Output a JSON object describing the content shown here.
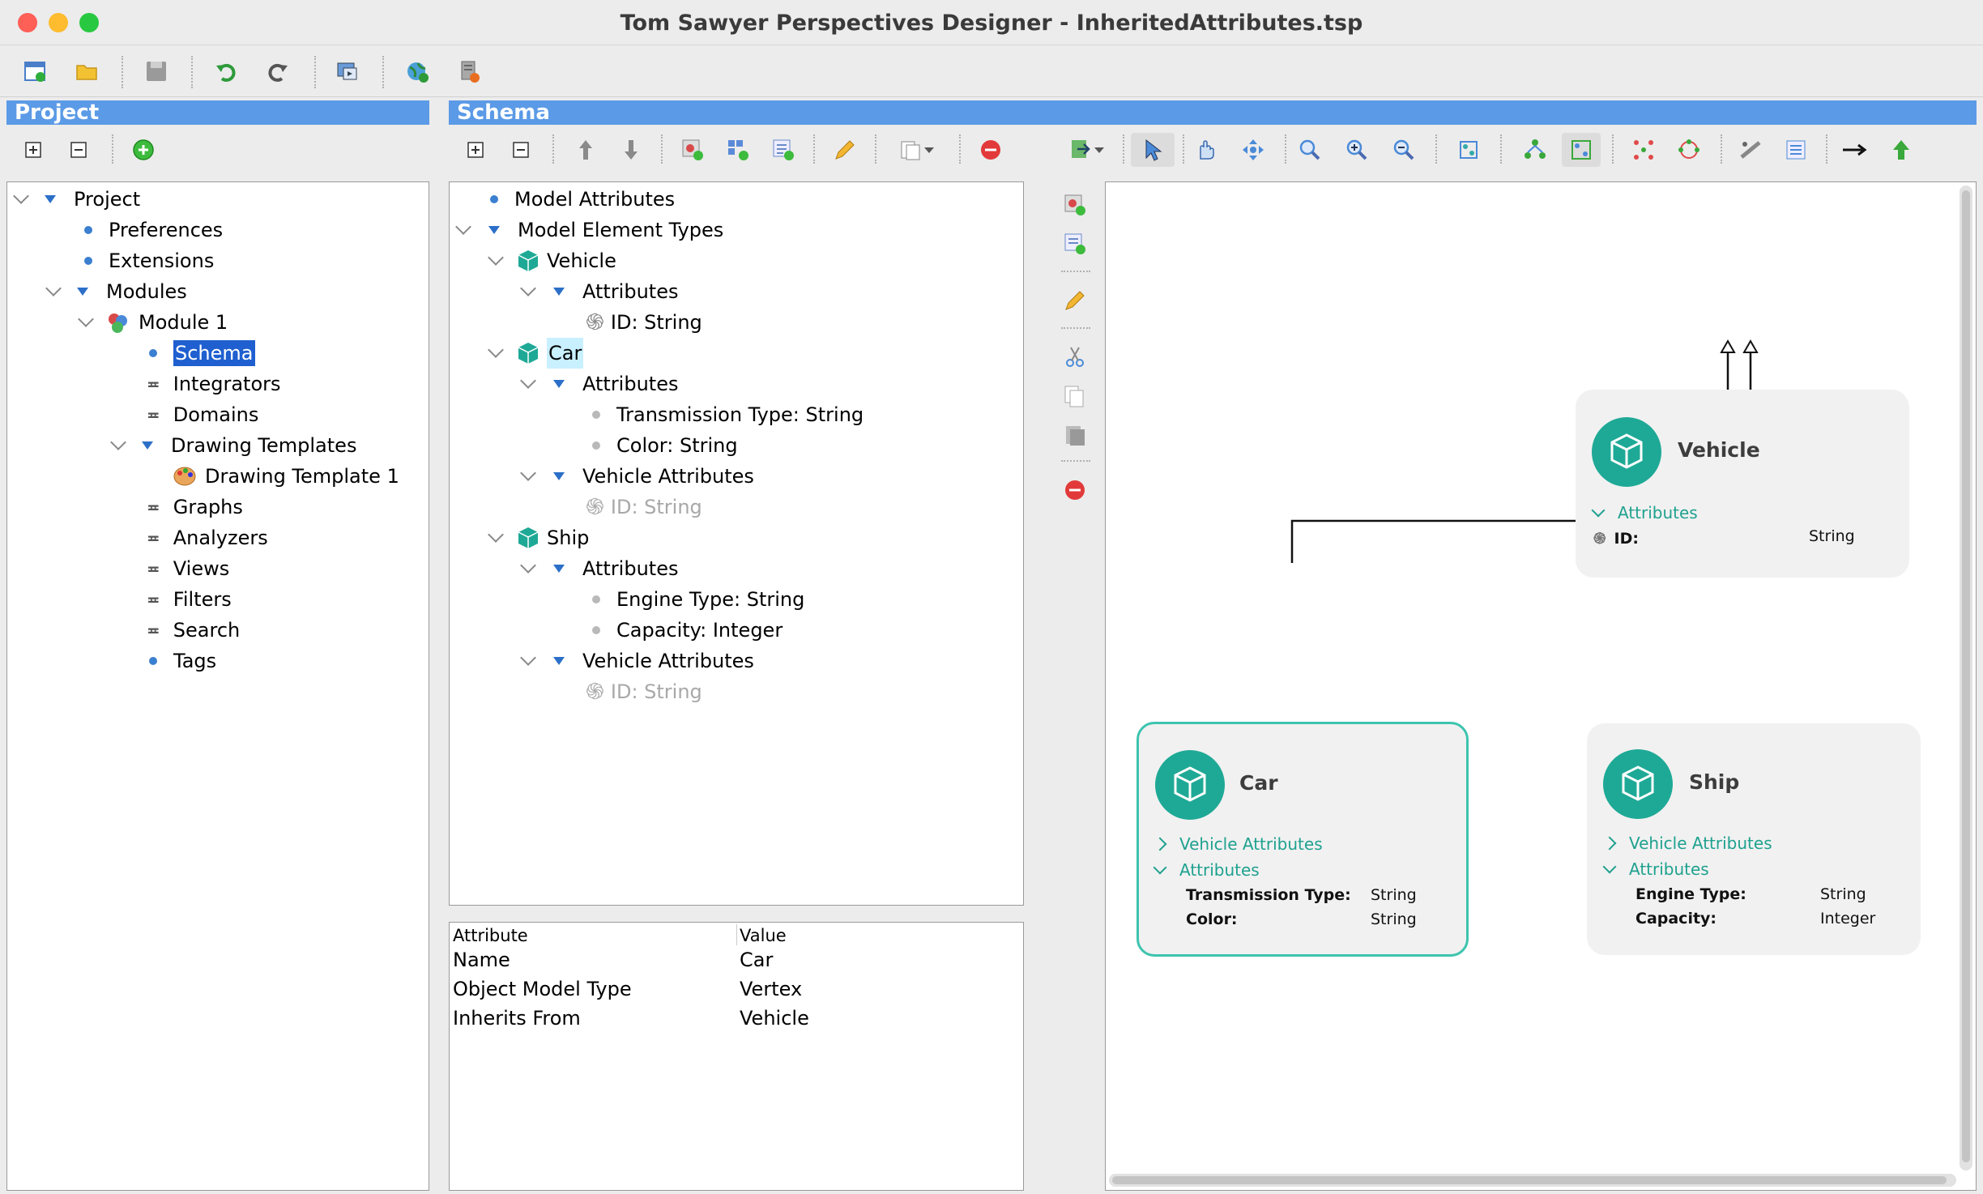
{
  "window": {
    "title": "Tom Sawyer Perspectives Designer - InheritedAttributes.tsp"
  },
  "project": {
    "header": "Project",
    "tree": {
      "project": "Project",
      "preferences": "Preferences",
      "extensions": "Extensions",
      "modules": "Modules",
      "module1": "Module 1",
      "schema": "Schema",
      "integrators": "Integrators",
      "domains": "Domains",
      "drawing_templates": "Drawing Templates",
      "drawing_template_1": "Drawing Template 1",
      "graphs": "Graphs",
      "analyzers": "Analyzers",
      "views": "Views",
      "filters": "Filters",
      "search": "Search",
      "tags": "Tags"
    }
  },
  "schema": {
    "header": "Schema",
    "tree": {
      "model_attributes": "Model Attributes",
      "model_element_types": "Model Element Types",
      "vehicle": "Vehicle",
      "vehicle_attributes": "Attributes",
      "vehicle_id": "ID: String",
      "car": "Car",
      "car_attributes": "Attributes",
      "car_transmission": "Transmission Type: String",
      "car_color": "Color: String",
      "car_vehicle_attributes": "Vehicle Attributes",
      "car_inherited_id": "ID: String",
      "ship": "Ship",
      "ship_attributes": "Attributes",
      "ship_engine": "Engine Type: String",
      "ship_capacity": "Capacity: Integer",
      "ship_vehicle_attributes": "Vehicle Attributes",
      "ship_inherited_id": "ID: String"
    },
    "properties": {
      "col_attribute": "Attribute",
      "col_value": "Value",
      "rows": [
        {
          "k": "Name",
          "v": "Car"
        },
        {
          "k": "Object Model Type",
          "v": "Vertex"
        },
        {
          "k": "Inherits From",
          "v": "Vehicle"
        }
      ]
    }
  },
  "diagram": {
    "vehicle": {
      "title": "Vehicle",
      "attributes_label": "Attributes",
      "rows": [
        {
          "k": "ID:",
          "v": "String"
        }
      ]
    },
    "car": {
      "title": "Car",
      "vehicle_attributes_label": "Vehicle Attributes",
      "attributes_label": "Attributes",
      "rows": [
        {
          "k": "Transmission Type:",
          "v": "String"
        },
        {
          "k": "Color:",
          "v": "String"
        }
      ]
    },
    "ship": {
      "title": "Ship",
      "vehicle_attributes_label": "Vehicle Attributes",
      "attributes_label": "Attributes",
      "rows": [
        {
          "k": "Engine Type:",
          "v": "String"
        },
        {
          "k": "Capacity:",
          "v": "Integer"
        }
      ]
    }
  },
  "colors": {
    "accent": "#5b9ae6",
    "teal": "#1ea996",
    "selection": "#1f5fd0"
  }
}
